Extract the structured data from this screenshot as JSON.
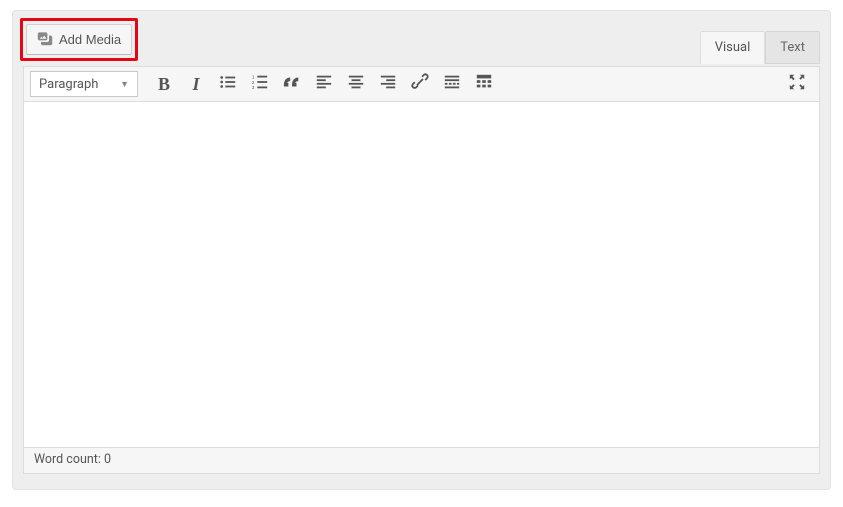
{
  "top": {
    "add_media_label": "Add Media",
    "tabs": {
      "visual": "Visual",
      "text": "Text"
    }
  },
  "toolbar": {
    "format_dropdown": "Paragraph"
  },
  "status": {
    "word_count_label": "Word count: 0"
  }
}
